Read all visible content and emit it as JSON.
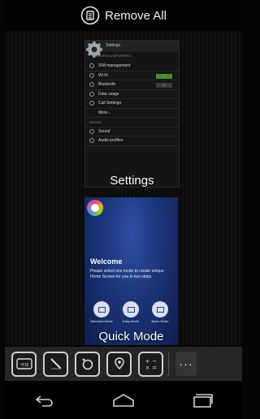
{
  "header": {
    "remove_all_label": "Remove All",
    "icon": "remove-all-icon"
  },
  "recents": [
    {
      "title": "Settings",
      "icon": "settings-gear-icon",
      "preview": {
        "header": "Settings",
        "subheader": "WIRELESS & NETWORKS",
        "rows": [
          {
            "label": "SIM management"
          },
          {
            "label": "Wi-Fi",
            "toggle": "I"
          },
          {
            "label": "Bluetooth",
            "toggle": "O"
          },
          {
            "label": "Data usage"
          },
          {
            "label": "Call Settings"
          },
          {
            "label": "More..."
          },
          {
            "label": "DEVICE",
            "section": true
          },
          {
            "label": "Sound"
          },
          {
            "label": "Audio profiles"
          }
        ]
      }
    },
    {
      "title": "Quick Mode",
      "icon": "quick-mode-logo-icon",
      "preview": {
        "welcome": "Welcome",
        "description": "Please select one mode to create unique Home Screen for you in two steps.",
        "modes": [
          "Standard Mode",
          "Easy Mode",
          "Basic Mode"
        ]
      }
    }
  ],
  "dock": {
    "apps": [
      "camera-switch-icon",
      "notes-icon",
      "camera-icon",
      "maps-icon",
      "calculator-icon"
    ],
    "more_label": "···"
  },
  "navbar": {
    "buttons": [
      "back-icon",
      "home-icon",
      "recent-apps-icon"
    ]
  }
}
